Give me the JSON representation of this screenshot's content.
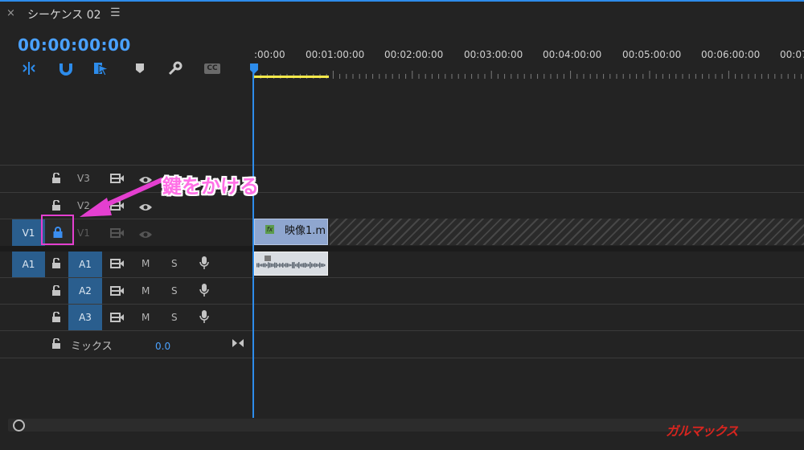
{
  "panel": {
    "close_glyph": "×",
    "sequence_title": "シーケンス 02",
    "menu_glyph": "☰",
    "timecode": "00:00:00:00"
  },
  "toolbar": {
    "icons": [
      "snap-icon",
      "magnet-icon",
      "linked-selection-icon",
      "marker-icon",
      "wrench-icon",
      "captions-icon"
    ],
    "captions_label": "CC"
  },
  "ruler": {
    "labels": [
      ":00:00",
      "00:01:00:00",
      "00:02:00:00",
      "00:03:00:00",
      "00:04:00:00",
      "00:05:00:00",
      "00:06:00:00",
      "00:07"
    ]
  },
  "tracks": {
    "video": [
      {
        "target": "",
        "name": "V3",
        "locked": false
      },
      {
        "target": "",
        "name": "V2",
        "locked": false
      },
      {
        "target": "V1",
        "name": "V1",
        "locked": true
      }
    ],
    "audio": [
      {
        "target": "A1",
        "name": "A1",
        "mute": "M",
        "solo": "S"
      },
      {
        "target": "",
        "name": "A2",
        "mute": "M",
        "solo": "S"
      },
      {
        "target": "",
        "name": "A3",
        "mute": "M",
        "solo": "S"
      }
    ],
    "mix": {
      "label": "ミックス",
      "value": "0.0"
    }
  },
  "clips": {
    "video_clip_name": "映像1.m",
    "fx_label": "fx"
  },
  "annotation": {
    "text": "鍵をかける",
    "color": "#ff6fe6"
  },
  "watermark": "ガルマックス",
  "colors": {
    "accent": "#2d8ceb",
    "timecode": "#4aa1ff",
    "work_area": "#f6e94a",
    "annotation_box": "#e43fd0"
  }
}
